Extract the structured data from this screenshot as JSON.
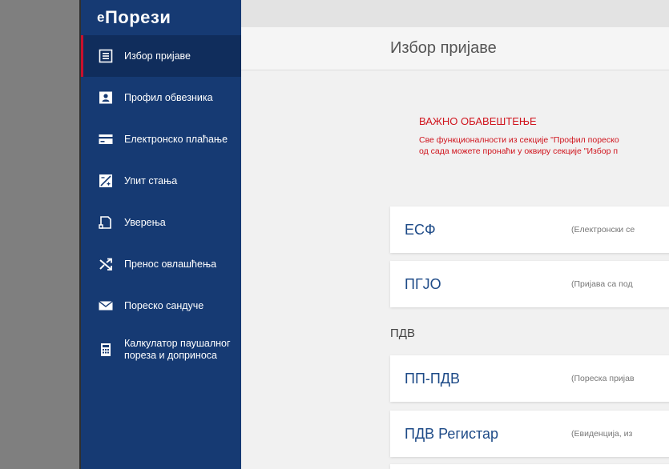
{
  "app": {
    "logo_small": "е",
    "logo_rest": "Порези"
  },
  "sidebar": {
    "items": [
      {
        "label": "Избор пријаве",
        "icon": "list-icon"
      },
      {
        "label": "Профил обвезника",
        "icon": "profile-icon"
      },
      {
        "label": "Електронско плаћање",
        "icon": "card-icon"
      },
      {
        "label": "Упит стања",
        "icon": "balance-icon"
      },
      {
        "label": "Уверења",
        "icon": "certificate-icon"
      },
      {
        "label": "Пренос овлашћења",
        "icon": "shuffle-icon"
      },
      {
        "label": "Пореско сандуче",
        "icon": "envelope-icon"
      },
      {
        "label_line1": "Калкулатор паушалног",
        "label_line2": "пореза и доприноса",
        "icon": "calculator-icon"
      }
    ]
  },
  "main": {
    "page_title": "Избор пријаве",
    "notice": {
      "title": "ВАЖНО ОБАВЕШТЕЊЕ",
      "line1": "Све функционалности из секције \"Профил пореско",
      "line2": "од сада можете пронаћи у оквиру секције \"Избор п"
    },
    "cards": [
      {
        "title": "ЕСФ",
        "desc": "(Електронски се"
      },
      {
        "title": "ПГЈО",
        "desc": "(Пријава са под"
      }
    ],
    "section_pdv": "ПДВ",
    "pdv_cards": [
      {
        "title": "ПП-ПДВ",
        "desc": "(Пореска пријав"
      },
      {
        "title": "ПДВ Регистар",
        "desc": "(Евиденција, из"
      }
    ]
  }
}
